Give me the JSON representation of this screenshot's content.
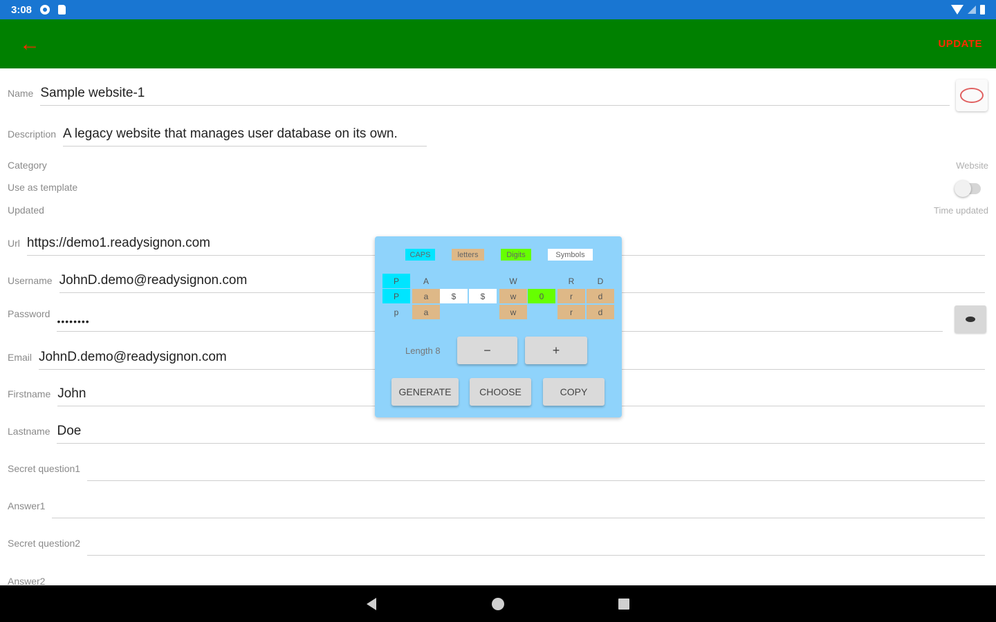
{
  "status_bar": {
    "time": "3:08"
  },
  "app_bar": {
    "update_label": "UPDATE"
  },
  "form": {
    "name": {
      "label": "Name",
      "value": "Sample website-1"
    },
    "description": {
      "label": "Description",
      "value": "A legacy website that manages user database on its own."
    },
    "category": {
      "label": "Category",
      "value": "Website"
    },
    "use_as_template": {
      "label": "Use as template"
    },
    "updated": {
      "label": "Updated",
      "value": "Time updated"
    },
    "url": {
      "label": "Url",
      "value": "https://demo1.readysignon.com"
    },
    "username": {
      "label": "Username",
      "value": "JohnD.demo@readysignon.com"
    },
    "password": {
      "label": "Password",
      "value": "••••••••"
    },
    "email": {
      "label": "Email",
      "value": "JohnD.demo@readysignon.com"
    },
    "firstname": {
      "label": "Firstname",
      "value": "John"
    },
    "lastname": {
      "label": "Lastname",
      "value": "Doe"
    },
    "secret_question1": {
      "label": "Secret question1",
      "value": ""
    },
    "answer1": {
      "label": "Answer1",
      "value": ""
    },
    "secret_question2": {
      "label": "Secret question2",
      "value": ""
    },
    "answer2": {
      "label": "Answer2"
    }
  },
  "generator": {
    "chips": [
      {
        "label": "CAPS",
        "color": "#00e5ff"
      },
      {
        "label": "letters",
        "color": "#deb887"
      },
      {
        "label": "Digits",
        "color": "#66ff00"
      },
      {
        "label": "Symbols",
        "color": "#ffffff"
      }
    ],
    "rows": [
      [
        "P",
        "A",
        "",
        "",
        "W",
        "",
        "R",
        "D"
      ],
      [
        "P",
        "a",
        "$",
        "$",
        "w",
        "0",
        "r",
        "d"
      ],
      [
        "p",
        "a",
        "",
        "",
        "w",
        "",
        "r",
        "d"
      ]
    ],
    "length_label": "Length 8",
    "minus_label": "−",
    "plus_label": "+",
    "generate_label": "GENERATE",
    "choose_label": "CHOOSE",
    "copy_label": "COPY"
  }
}
